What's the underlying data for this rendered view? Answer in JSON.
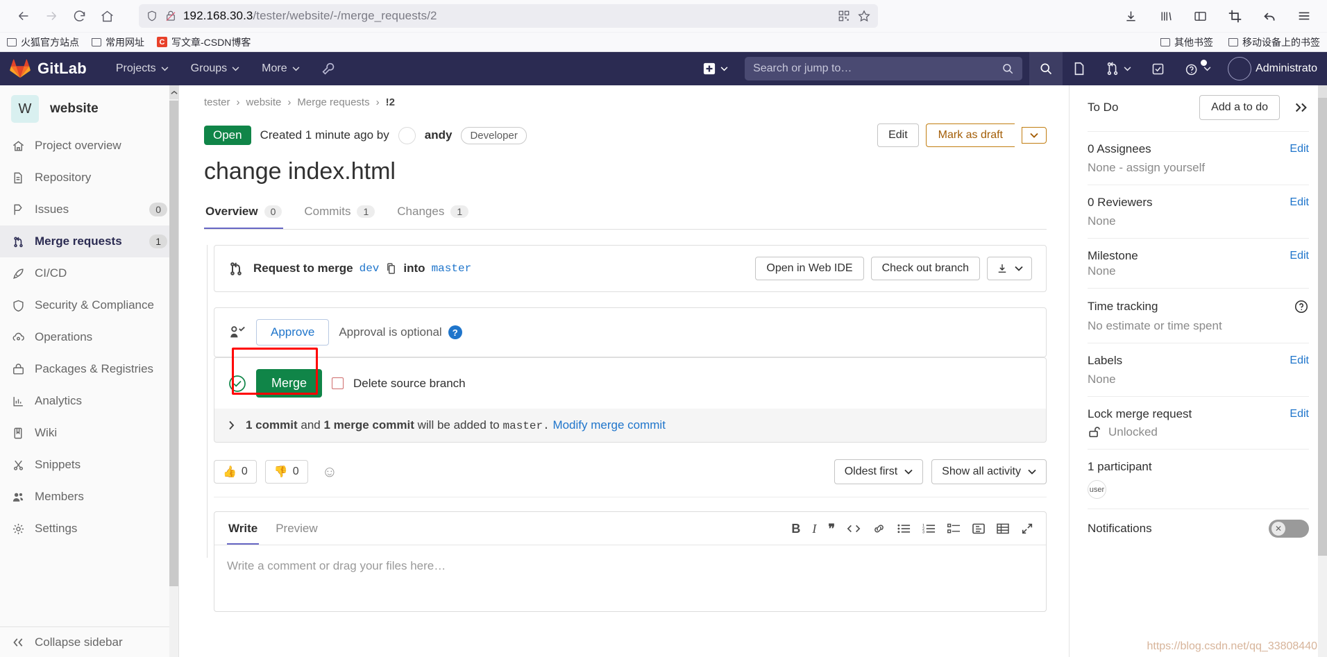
{
  "browser": {
    "url_host": "192.168.30.3",
    "url_path": "/tester/website/-/merge_requests/2",
    "nav": {
      "back": "back-arrow",
      "forward": "forward-arrow",
      "reload": "reload",
      "home": "home"
    },
    "bookmarks": [
      {
        "label": "火狐官方站点",
        "icon": "folder-icon"
      },
      {
        "label": "常用网址",
        "icon": "folder-icon"
      },
      {
        "label": "写文章-CSDN博客",
        "icon": "csdn-favicon",
        "favicon_letter": "C"
      }
    ],
    "bookmarks_right": [
      {
        "label": "其他书签",
        "icon": "folder-icon"
      },
      {
        "label": "移动设备上的书签",
        "icon": "folder-icon"
      }
    ]
  },
  "navbar": {
    "brand": "GitLab",
    "items": [
      {
        "label": "Projects"
      },
      {
        "label": "Groups"
      },
      {
        "label": "More"
      }
    ],
    "search_placeholder": "Search or jump to…",
    "user_name": "Administrato"
  },
  "sidebar": {
    "project_initial": "W",
    "project_name": "website",
    "items": [
      {
        "label": "Project overview",
        "icon": "home-icon",
        "badge": null,
        "active": false
      },
      {
        "label": "Repository",
        "icon": "document-icon",
        "badge": null,
        "active": false
      },
      {
        "label": "Issues",
        "icon": "issue-icon",
        "badge": "0",
        "active": false
      },
      {
        "label": "Merge requests",
        "icon": "merge-icon",
        "badge": "1",
        "active": true
      },
      {
        "label": "CI/CD",
        "icon": "rocket-icon",
        "badge": null,
        "active": false
      },
      {
        "label": "Security & Compliance",
        "icon": "shield-icon",
        "badge": null,
        "active": false
      },
      {
        "label": "Operations",
        "icon": "cloud-gear-icon",
        "badge": null,
        "active": false
      },
      {
        "label": "Packages & Registries",
        "icon": "package-icon",
        "badge": null,
        "active": false
      },
      {
        "label": "Analytics",
        "icon": "chart-icon",
        "badge": null,
        "active": false
      },
      {
        "label": "Wiki",
        "icon": "book-icon",
        "badge": null,
        "active": false
      },
      {
        "label": "Snippets",
        "icon": "scissors-icon",
        "badge": null,
        "active": false
      },
      {
        "label": "Members",
        "icon": "users-icon",
        "badge": null,
        "active": false
      },
      {
        "label": "Settings",
        "icon": "gear-icon",
        "badge": null,
        "active": false
      }
    ],
    "collapse_label": "Collapse sidebar"
  },
  "main": {
    "breadcrumb": [
      "tester",
      "website",
      "Merge requests",
      "!2"
    ],
    "status_badge": "Open",
    "created_text": "Created 1 minute ago by",
    "author": "andy",
    "author_role": "Developer",
    "edit_button": "Edit",
    "draft_button": "Mark as draft",
    "title": "change index.html",
    "tabs": [
      {
        "label": "Overview",
        "count": "0",
        "active": true
      },
      {
        "label": "Commits",
        "count": "1",
        "active": false
      },
      {
        "label": "Changes",
        "count": "1",
        "active": false
      }
    ],
    "merge_widget": {
      "request_label": "Request to merge",
      "source_branch": "dev",
      "into_label": "into",
      "target_branch": "master",
      "web_ide_button": "Open in Web IDE",
      "checkout_button": "Check out branch"
    },
    "approval": {
      "approve_button": "Approve",
      "status_text": "Approval is optional",
      "help_glyph": "?"
    },
    "merge_box": {
      "merge_button": "Merge",
      "delete_source_branch": "Delete source branch",
      "commit_note_prefix": "1 commit",
      "commit_note_and": "and",
      "commit_note_merge": "1 merge commit",
      "commit_note_mid": "will be added to",
      "commit_note_branch": "master.",
      "commit_note_link": "Modify merge commit"
    },
    "activity": {
      "thumbsup_count": "0",
      "thumbsdown_count": "0",
      "sort_label": "Oldest first",
      "filter_label": "Show all activity"
    },
    "editor": {
      "write_tab": "Write",
      "preview_tab": "Preview",
      "placeholder": "Write a comment or drag your files here…",
      "tools": [
        "bold-icon",
        "italic-icon",
        "quote-icon",
        "code-icon",
        "link-icon",
        "bullet-list-icon",
        "numbered-list-icon",
        "task-list-icon",
        "collapse-block-icon",
        "table-icon",
        "fullscreen-icon"
      ]
    }
  },
  "right_sidebar": {
    "todo_label": "To Do",
    "todo_button": "Add a to do",
    "blocks": [
      {
        "title": "0 Assignees",
        "action": "Edit",
        "value": "None - assign yourself"
      },
      {
        "title": "0 Reviewers",
        "action": "Edit",
        "value": "None"
      },
      {
        "title": "Milestone",
        "action": "Edit",
        "value": "None"
      },
      {
        "title": "Time tracking",
        "action": "help-icon",
        "value": "No estimate or time spent"
      },
      {
        "title": "Labels",
        "action": "Edit",
        "value": "None"
      },
      {
        "title": "Lock merge request",
        "action": "Edit",
        "value": "Unlocked"
      },
      {
        "title": "1 participant",
        "action": "",
        "value": "user"
      },
      {
        "title": "Notifications",
        "action": "",
        "value": ""
      }
    ],
    "watermark": "https://blog.csdn.net/qq_33808440"
  },
  "colors": {
    "gitlab_navy": "#2b2b52",
    "open_green": "#108548",
    "link_blue": "#1f75cb",
    "draft_orange": "#a35d06",
    "highlight_red": "#ff0000"
  }
}
